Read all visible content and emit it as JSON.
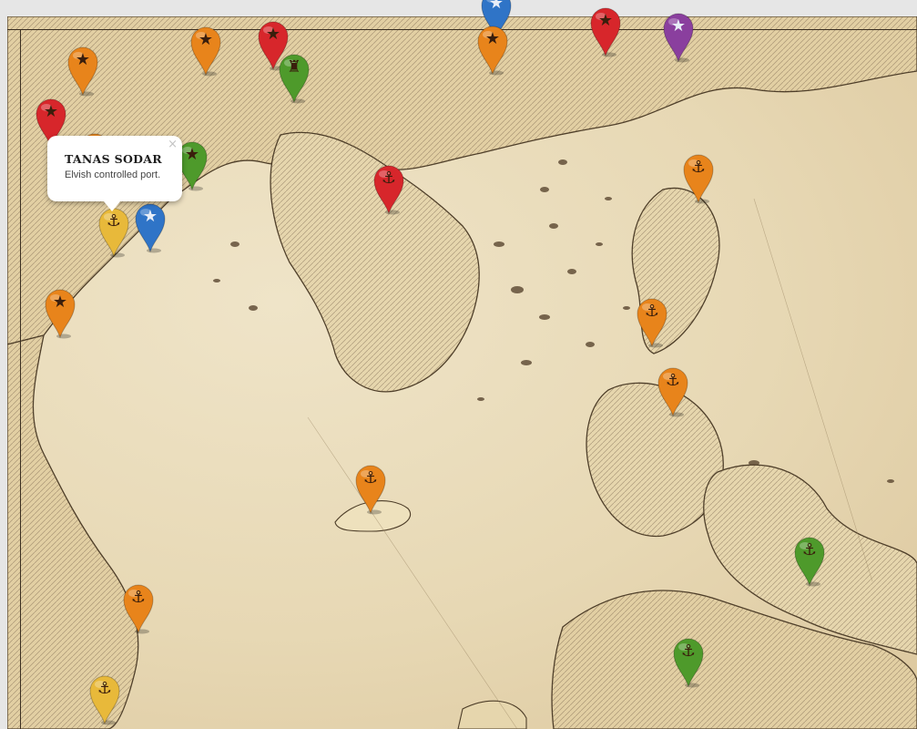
{
  "popup": {
    "title": "TANAS SODAR",
    "description": "Elvish controlled port.",
    "close_symbol": "×"
  },
  "marker_colors": {
    "orange": "#e8841b",
    "red": "#d7262b",
    "green": "#4e9a2b",
    "blue": "#2f74c7",
    "yellow": "#e8b93a",
    "purple": "#8a3f9e"
  },
  "markers": [
    {
      "icon": "star",
      "color": "orange"
    },
    {
      "icon": "star",
      "color": "orange"
    },
    {
      "icon": "star",
      "color": "red"
    },
    {
      "icon": "castle",
      "color": "green"
    },
    {
      "icon": "star",
      "color": "blue"
    },
    {
      "icon": "star",
      "color": "orange"
    },
    {
      "icon": "star",
      "color": "red"
    },
    {
      "icon": "star",
      "color": "purple"
    },
    {
      "icon": "star",
      "color": "red"
    },
    {
      "icon": "star",
      "color": "orange"
    },
    {
      "icon": "star",
      "color": "green"
    },
    {
      "icon": "anchor",
      "color": "yellow"
    },
    {
      "icon": "star",
      "color": "blue"
    },
    {
      "icon": "anchor",
      "color": "red"
    },
    {
      "icon": "anchor",
      "color": "orange"
    },
    {
      "icon": "star",
      "color": "orange"
    },
    {
      "icon": "anchor",
      "color": "orange"
    },
    {
      "icon": "anchor",
      "color": "orange"
    },
    {
      "icon": "anchor",
      "color": "orange"
    },
    {
      "icon": "anchor",
      "color": "green"
    },
    {
      "icon": "anchor",
      "color": "orange"
    },
    {
      "icon": "anchor",
      "color": "green"
    },
    {
      "icon": "anchor",
      "color": "yellow"
    }
  ]
}
